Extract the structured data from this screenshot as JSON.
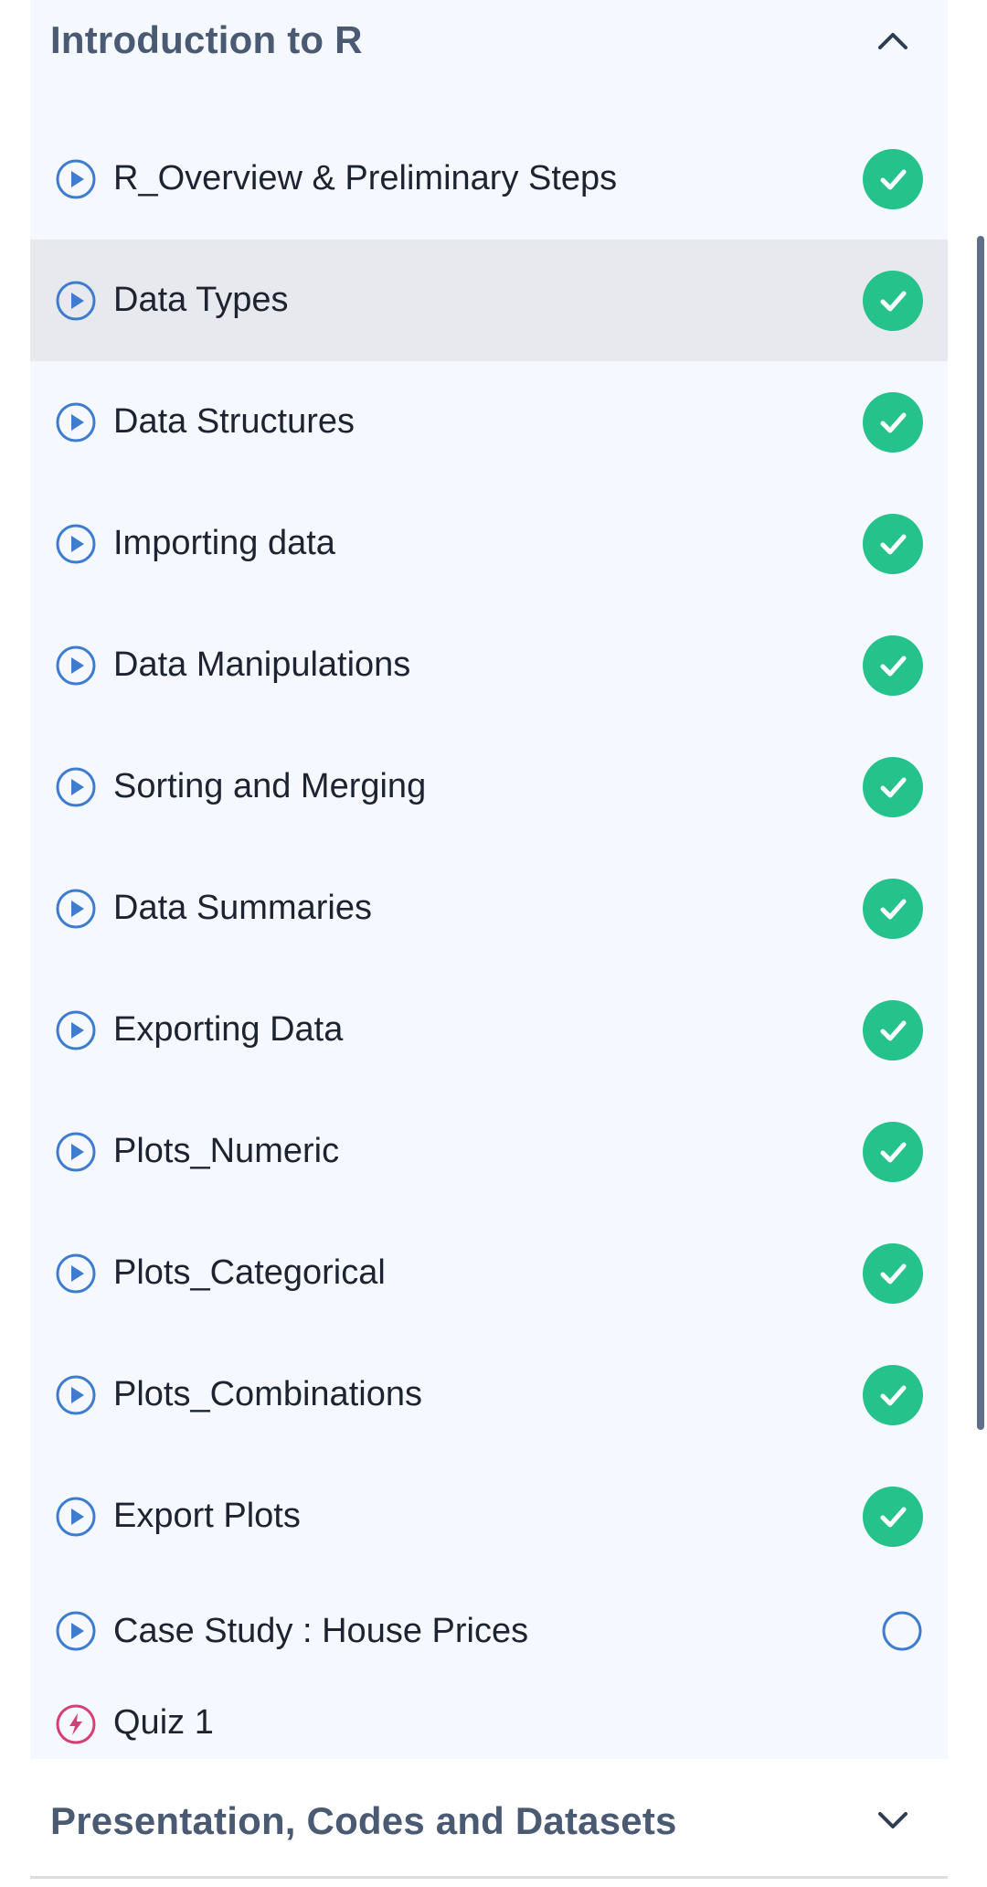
{
  "course": {
    "section_open": {
      "title": "Introduction to R"
    },
    "lessons": [
      {
        "label": "R_Overview & Preliminary Steps",
        "type": "video",
        "status": "completed"
      },
      {
        "label": "Data Types",
        "type": "video",
        "status": "completed",
        "active": true
      },
      {
        "label": "Data Structures",
        "type": "video",
        "status": "completed"
      },
      {
        "label": "Importing data",
        "type": "video",
        "status": "completed"
      },
      {
        "label": "Data Manipulations",
        "type": "video",
        "status": "completed"
      },
      {
        "label": "Sorting and Merging",
        "type": "video",
        "status": "completed"
      },
      {
        "label": "Data Summaries",
        "type": "video",
        "status": "completed"
      },
      {
        "label": "Exporting Data",
        "type": "video",
        "status": "completed"
      },
      {
        "label": "Plots_Numeric",
        "type": "video",
        "status": "completed"
      },
      {
        "label": "Plots_Categorical",
        "type": "video",
        "status": "completed"
      },
      {
        "label": "Plots_Combinations",
        "type": "video",
        "status": "completed"
      },
      {
        "label": "Export Plots",
        "type": "video",
        "status": "completed"
      },
      {
        "label": "Case Study : House Prices",
        "type": "video",
        "status": "not-started"
      },
      {
        "label": "Quiz 1",
        "type": "quiz",
        "status": "none"
      }
    ],
    "section_collapsed": {
      "title": "Presentation, Codes and Datasets"
    }
  },
  "icons": {
    "play": "play-circle-icon",
    "quiz": "lightning-circle-icon",
    "completed": "check-circle-icon",
    "not_started": "empty-circle-icon",
    "collapse": "chevron-up-icon",
    "expand": "chevron-down-icon"
  },
  "colors": {
    "panel_bg": "#f5f8ff",
    "active_row_bg": "#e7e9ee",
    "completed_green": "#25c28b",
    "play_blue": "#3d7ccf",
    "quiz_pink": "#d53f76",
    "section_title": "#4a5a73",
    "lesson_text": "#1d2330"
  }
}
